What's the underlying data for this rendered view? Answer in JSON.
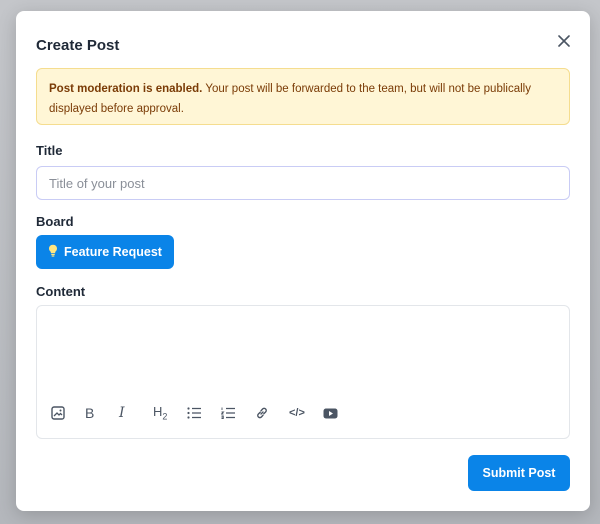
{
  "modal": {
    "title": "Create Post"
  },
  "alert": {
    "bold": "Post moderation is enabled.",
    "text": " Your post will be forwarded to the team, but will not be publically displayed before approval."
  },
  "fields": {
    "title_label": "Title",
    "title_placeholder": "Title of your post",
    "title_value": "",
    "board_label": "Board",
    "board_value": "Feature Request",
    "content_label": "Content"
  },
  "toolbar": {
    "icons": [
      "image-icon",
      "bold-icon",
      "italic-icon",
      "heading2-icon",
      "bullet-list-icon",
      "numbered-list-icon",
      "link-icon",
      "code-icon",
      "youtube-icon"
    ],
    "bold_glyph": "B",
    "italic_glyph": "I",
    "heading_glyph": "H",
    "heading_sub": "2",
    "code_glyph": "</>"
  },
  "actions": {
    "submit_label": "Submit Post"
  },
  "colors": {
    "primary": "#0a84e8",
    "alert_bg": "#fff6d6",
    "alert_text": "#7a3b06"
  }
}
